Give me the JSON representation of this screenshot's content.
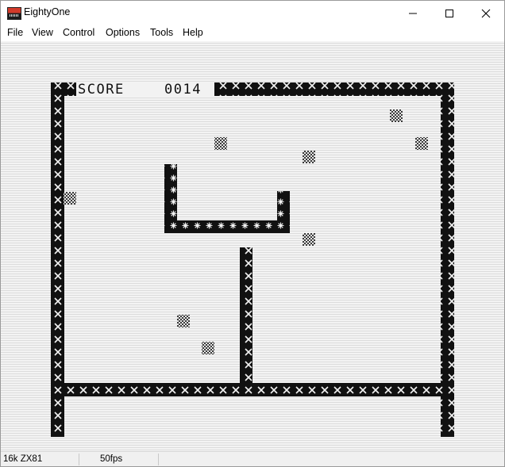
{
  "window": {
    "title": "EightyOne"
  },
  "menu": {
    "items": [
      "File",
      "View",
      "Control",
      "Options",
      "Tools",
      "Help"
    ]
  },
  "game": {
    "score_label": "SCORE",
    "score_value": "0014",
    "colors": {
      "ink": "#111111",
      "food": "#555555"
    }
  },
  "status": {
    "machine": "16k ZX81",
    "fps": "50fps"
  }
}
